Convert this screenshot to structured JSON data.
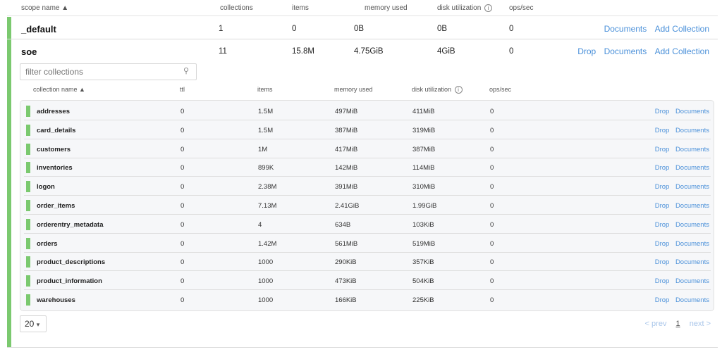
{
  "scope_table": {
    "headers": {
      "name": "scope name ▲",
      "collections": "collections",
      "items": "items",
      "memory": "memory used",
      "disk": "disk utilization",
      "ops": "ops/sec"
    },
    "info_icon": "i",
    "scopes": [
      {
        "name": "_default",
        "collections": "1",
        "items": "0",
        "memory": "0B",
        "disk": "0B",
        "ops": "0",
        "actions": [
          "Documents",
          "Add Collection"
        ]
      },
      {
        "name": "soe",
        "collections": "11",
        "items": "15.8M",
        "memory": "4.75GiB",
        "disk": "4GiB",
        "ops": "0",
        "actions": [
          "Drop",
          "Documents",
          "Add Collection"
        ]
      }
    ]
  },
  "collections_panel": {
    "filter_placeholder": "filter collections",
    "search_icon": "⚲",
    "headers": {
      "name": "collection name ▲",
      "ttl": "ttl",
      "items": "items",
      "memory": "memory used",
      "disk": "disk utilization",
      "ops": "ops/sec"
    },
    "row_actions": {
      "drop": "Drop",
      "documents": "Documents"
    },
    "rows": [
      {
        "name": "addresses",
        "ttl": "0",
        "items": "1.5M",
        "memory": "497MiB",
        "disk": "411MiB",
        "ops": "0"
      },
      {
        "name": "card_details",
        "ttl": "0",
        "items": "1.5M",
        "memory": "387MiB",
        "disk": "319MiB",
        "ops": "0"
      },
      {
        "name": "customers",
        "ttl": "0",
        "items": "1M",
        "memory": "417MiB",
        "disk": "387MiB",
        "ops": "0"
      },
      {
        "name": "inventories",
        "ttl": "0",
        "items": "899K",
        "memory": "142MiB",
        "disk": "114MiB",
        "ops": "0"
      },
      {
        "name": "logon",
        "ttl": "0",
        "items": "2.38M",
        "memory": "391MiB",
        "disk": "310MiB",
        "ops": "0"
      },
      {
        "name": "order_items",
        "ttl": "0",
        "items": "7.13M",
        "memory": "2.41GiB",
        "disk": "1.99GiB",
        "ops": "0"
      },
      {
        "name": "orderentry_metadata",
        "ttl": "0",
        "items": "4",
        "memory": "634B",
        "disk": "103KiB",
        "ops": "0"
      },
      {
        "name": "orders",
        "ttl": "0",
        "items": "1.42M",
        "memory": "561MiB",
        "disk": "519MiB",
        "ops": "0"
      },
      {
        "name": "product_descriptions",
        "ttl": "0",
        "items": "1000",
        "memory": "290KiB",
        "disk": "357KiB",
        "ops": "0"
      },
      {
        "name": "product_information",
        "ttl": "0",
        "items": "1000",
        "memory": "473KiB",
        "disk": "504KiB",
        "ops": "0"
      },
      {
        "name": "warehouses",
        "ttl": "0",
        "items": "1000",
        "memory": "166KiB",
        "disk": "225KiB",
        "ops": "0"
      }
    ],
    "page_size": "20",
    "page_size_caret": "▾",
    "pager": {
      "prev": "< prev",
      "current": "1",
      "next": "next >"
    }
  },
  "colors": {
    "accent_link": "#4a90d9",
    "status_green": "#7bc96f"
  }
}
